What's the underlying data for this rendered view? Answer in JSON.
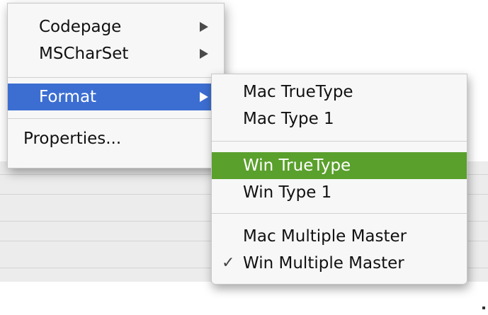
{
  "main_menu": {
    "items": [
      {
        "label": "Codepage",
        "has_submenu": true
      },
      {
        "label": "MSCharSet",
        "has_submenu": true
      },
      {
        "label": "Format",
        "has_submenu": true,
        "selected": true
      },
      {
        "label": "Properties..."
      }
    ]
  },
  "format_submenu": {
    "items": [
      {
        "label": "Mac TrueType"
      },
      {
        "label": "Mac Type 1"
      },
      {
        "label": "Win TrueType",
        "highlighted": true
      },
      {
        "label": "Win Type 1"
      },
      {
        "label": "Mac Multiple Master"
      },
      {
        "label": "Win Multiple Master",
        "checked": true,
        "check_mark": "✓"
      }
    ]
  },
  "colors": {
    "selection_blue": "#3c6ed2",
    "highlight_green": "#5aa02c",
    "menu_background": "#f7f7f7"
  },
  "icons": {
    "submenu_arrow": "chevron-right-icon",
    "checkmark": "checkmark-icon"
  }
}
